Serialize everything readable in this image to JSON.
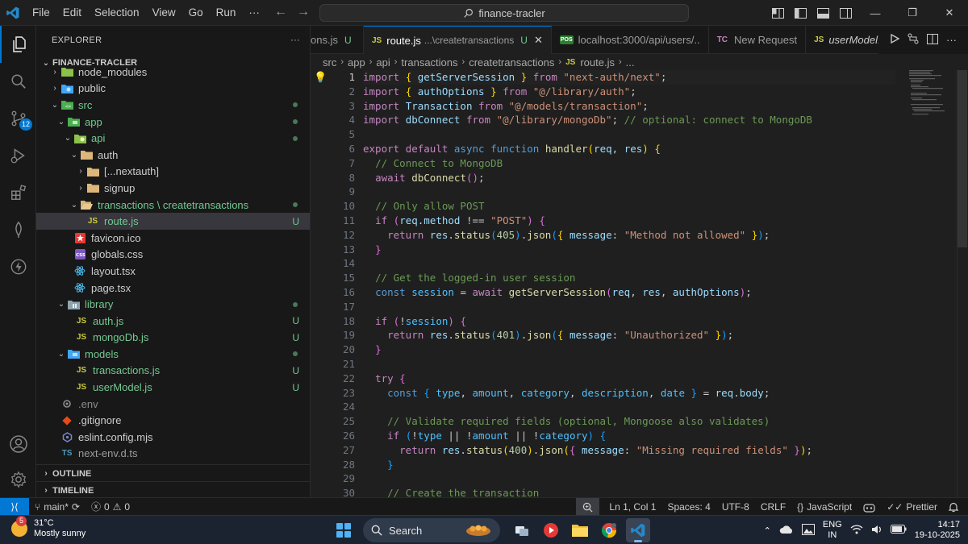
{
  "titlebar": {
    "menu": [
      "File",
      "Edit",
      "Selection",
      "View",
      "Go",
      "Run"
    ],
    "more": "···",
    "search_text": "finance-tracler"
  },
  "activity": {
    "scm_badge": "12"
  },
  "explorer": {
    "title": "EXPLORER",
    "more": "···",
    "project": "FINANCE-TRACLER",
    "items": [
      {
        "label": "node_modules",
        "status": ""
      },
      {
        "label": "public",
        "status": ""
      },
      {
        "label": "src",
        "status": ""
      },
      {
        "label": "app",
        "status": ""
      },
      {
        "label": "api",
        "status": ""
      },
      {
        "label": "auth",
        "status": ""
      },
      {
        "label": "[...nextauth]",
        "status": ""
      },
      {
        "label": "signup",
        "status": ""
      },
      {
        "label": "transactions \\ createtransactions",
        "status": ""
      },
      {
        "label": "route.js",
        "status": "U"
      },
      {
        "label": "favicon.ico",
        "status": ""
      },
      {
        "label": "globals.css",
        "status": ""
      },
      {
        "label": "layout.tsx",
        "status": ""
      },
      {
        "label": "page.tsx",
        "status": ""
      },
      {
        "label": "library",
        "status": ""
      },
      {
        "label": "auth.js",
        "status": "U"
      },
      {
        "label": "mongoDb.js",
        "status": "U"
      },
      {
        "label": "models",
        "status": ""
      },
      {
        "label": "transactions.js",
        "status": "U"
      },
      {
        "label": "userModel.js",
        "status": "U"
      },
      {
        "label": ".env",
        "status": ""
      },
      {
        "label": ".gitignore",
        "status": ""
      },
      {
        "label": "eslint.config.mjs",
        "status": ""
      },
      {
        "label": "next-env.d.ts",
        "status": ""
      }
    ],
    "outline": "OUTLINE",
    "timeline": "TIMELINE"
  },
  "tabs": [
    {
      "label": "ons.js",
      "status": "U"
    },
    {
      "label": "route.js",
      "desc": "...\\createtransactions",
      "status": "U"
    },
    {
      "label": "localhost:3000/api/users/..",
      "icon": "POS"
    },
    {
      "label": "New Request",
      "icon": "TC"
    },
    {
      "label": "userModel.js",
      "icon": "JS"
    }
  ],
  "breadcrumbs": [
    "src",
    "app",
    "api",
    "transactions",
    "createtransactions",
    "route.js",
    "..."
  ],
  "editor": {
    "line_numbers": [
      "1",
      "2",
      "3",
      "4",
      "5",
      "6",
      "7",
      "8",
      "9",
      "10",
      "11",
      "12",
      "13",
      "14",
      "15",
      "16",
      "17",
      "18",
      "19",
      "20",
      "21",
      "22",
      "23",
      "24",
      "25",
      "26",
      "27",
      "28",
      "29",
      "30"
    ]
  },
  "statusbar": {
    "branch": "main*",
    "errors": "0",
    "warnings": "0",
    "position": "Ln 1, Col 1",
    "spaces": "Spaces: 4",
    "encoding": "UTF-8",
    "eol": "CRLF",
    "language_braces": "{}",
    "language": "JavaScript",
    "prettier": "Prettier"
  },
  "taskbar": {
    "weather_badge": "5",
    "temperature": "31°C",
    "condition": "Mostly sunny",
    "search": "Search",
    "lang_top": "ENG",
    "lang_bottom": "IN",
    "time": "14:17",
    "date": "19-10-2025"
  }
}
